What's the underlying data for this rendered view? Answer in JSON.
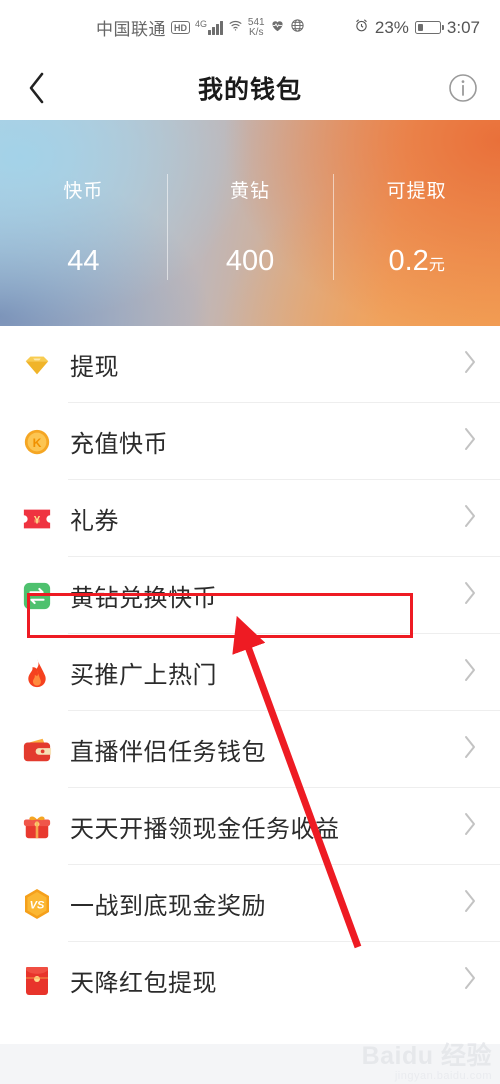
{
  "statusbar": {
    "carrier": "中国联通",
    "hd_badge": "HD",
    "network_type": "4G",
    "speed_value": "541",
    "speed_unit": "K/s",
    "heart_icon": "heart-icon",
    "globe_icon": "globe-icon",
    "alarm_icon": "alarm-clock-icon",
    "battery_percent": "23%",
    "time": "3:07"
  },
  "header": {
    "back_icon": "back-chevron-icon",
    "title": "我的钱包",
    "info_icon": "info-circle-icon"
  },
  "banner": {
    "stats": [
      {
        "label": "快币",
        "value": "44",
        "unit": ""
      },
      {
        "label": "黄钻",
        "value": "400",
        "unit": ""
      },
      {
        "label": "可提取",
        "value": "0.2",
        "unit": "元"
      }
    ]
  },
  "list": {
    "items": [
      {
        "label": "提现",
        "icon": "diamond-icon",
        "chevron": "chevron-right-icon"
      },
      {
        "label": "充值快币",
        "icon": "k-coin-icon",
        "chevron": "chevron-right-icon"
      },
      {
        "label": "礼券",
        "icon": "gift-voucher-icon",
        "chevron": "chevron-right-icon"
      },
      {
        "label": "黄钻兑换快币",
        "icon": "exchange-icon",
        "chevron": "chevron-right-icon"
      },
      {
        "label": "买推广上热门",
        "icon": "flame-icon",
        "chevron": "chevron-right-icon"
      },
      {
        "label": "直播伴侣任务钱包",
        "icon": "wallet-icon",
        "chevron": "chevron-right-icon"
      },
      {
        "label": "天天开播领现金任务收益",
        "icon": "gift-box-icon",
        "chevron": "chevron-right-icon"
      },
      {
        "label": "一战到底现金奖励",
        "icon": "vs-hexagon-icon",
        "chevron": "chevron-right-icon"
      },
      {
        "label": "天降红包提现",
        "icon": "red-envelope-icon",
        "chevron": "chevron-right-icon"
      }
    ]
  },
  "annotations": {
    "highlight_color": "#ee1b23",
    "highlight_target": "黄钻兑换快币",
    "arrow_icon": "pointer-arrow-icon"
  },
  "watermark": {
    "main": "Baidu 经验",
    "sub": "jingyan.baidu.com"
  }
}
